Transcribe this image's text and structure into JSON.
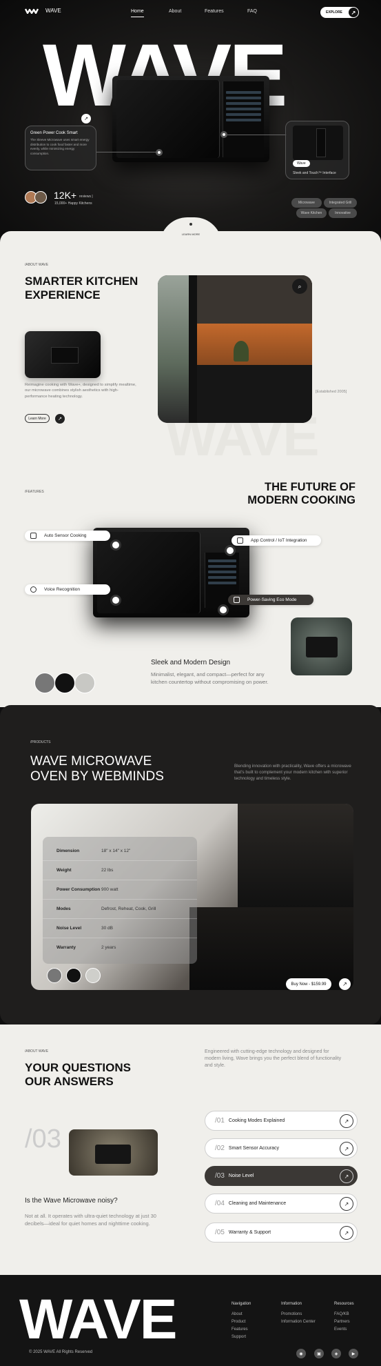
{
  "nav": {
    "brand": "WAVE",
    "links": [
      "Home",
      "About",
      "Features",
      "FAQ"
    ],
    "explore": "EXPLORE"
  },
  "hero": {
    "word": "WAVE",
    "card_title": "Green Power Cook Smart",
    "card_text": "The Sleeve Microwave uses smart energy distribution to cook food faster and more evenly, while minimizing energy consumption.",
    "card2_chip": "Wave",
    "card2_label": "Sleek and Touch™ Interface",
    "stat": "12K+",
    "stat_sub1": "reviews |",
    "stat_sub2": "15,000+ Happy Kitchens",
    "pills": [
      "Microwave",
      "Integrated Grill",
      "Wave Kitchen",
      "Innovative"
    ],
    "learn": "LEARN MORE"
  },
  "about": {
    "tag": "/ABOUT WAVE",
    "title1": "SMARTER KITCHEN",
    "title2": "EXPERIENCE",
    "text": "Reimagine cooking with Wave+, designed to simplify mealtime, our microwave combines stylish aesthetics with high-performance heating technology.",
    "button": "Learn More",
    "established": "[Established 2005]",
    "watermark": "WAVE"
  },
  "features": {
    "tag": "/FEATURES",
    "title1": "THE FUTURE OF",
    "title2": "MODERN COOKING",
    "items": [
      "Auto Sensor Cooking",
      "App Control / IoT Integration",
      "Voice Recognition",
      "Power-Saving Eco Mode"
    ],
    "design_title": "Sleek and Modern Design",
    "design_text": "Minimalist, elegant, and compact—perfect for any kitchen countertop without compromising on power."
  },
  "products": {
    "tag": "/PRODUCTS",
    "title1": "WAVE MICROWAVE",
    "title2": "OVEN BY WEBMINDS",
    "text": "Blending innovation with practicality, Wave offers a microwave that's built to complement your modern kitchen with superior technology and timeless style.",
    "specs": [
      {
        "k": "Dimension",
        "v": "18\" x 14\" x 12\""
      },
      {
        "k": "Weight",
        "v": "22 lbs"
      },
      {
        "k": "Power Consumption",
        "v": "900 watt"
      },
      {
        "k": "Modes",
        "v": "Defrost, Reheat, Cook, Grill"
      },
      {
        "k": "Noise Level",
        "v": "30 dB"
      },
      {
        "k": "Warranty",
        "v": "2 years"
      }
    ],
    "buy": "Buy Now - $159.99"
  },
  "faq": {
    "tag": "/ABOUT WAVE",
    "title1": "YOUR QUESTIONS",
    "title2": "OUR ANSWERS",
    "intro": "Engineered with cutting-edge technology and designed for modern living, Wave brings you the perfect blend of functionality and style.",
    "num": "/03",
    "question": "Is the Wave Microwave noisy?",
    "answer": "Not at all. It operates with ultra-quiet technology at just 30 decibels—ideal for quiet homes and nighttime cooking.",
    "items": [
      {
        "n": "/01",
        "t": "Cooking Modes Explained"
      },
      {
        "n": "/02",
        "t": "Smart Sensor Accuracy"
      },
      {
        "n": "/03",
        "t": "Noise Level"
      },
      {
        "n": "/04",
        "t": "Cleaning and Maintenance"
      },
      {
        "n": "/05",
        "t": "Warranty & Support"
      }
    ]
  },
  "footer": {
    "word": "WAVE",
    "copyright": "2025 WAVE All Rights Reserved",
    "cols": [
      {
        "t": "Navigation",
        "i": [
          "About",
          "Product",
          "Features",
          "Support"
        ]
      },
      {
        "t": "Information",
        "i": [
          "Promotions",
          "Information Center"
        ]
      },
      {
        "t": "Resources",
        "i": [
          "FAQ/KB",
          "Partners",
          "Events"
        ]
      }
    ]
  },
  "colors": {
    "dark": "#1f1e1d",
    "light": "#f0efeb",
    "accent": "#3b3835"
  }
}
